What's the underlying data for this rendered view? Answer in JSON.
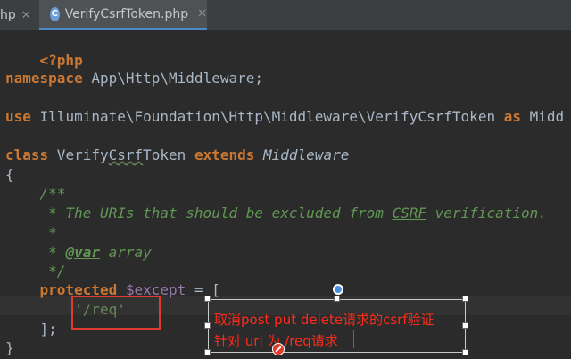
{
  "tabs": {
    "prev_label": "hp",
    "active_label": "VerifyCsrfToken.php",
    "active_icon": "php-file-icon"
  },
  "code": {
    "php_open": "<?php",
    "ns_kw": "namespace",
    "ns_name": " App\\Http\\Middleware;",
    "use_kw": "use",
    "use_path": " Illuminate\\Foundation\\Http\\Middleware\\VerifyCsrfToken ",
    "as_kw": "as",
    "as_name": " Midd",
    "class_kw": "class",
    "class_name_a": " Verify",
    "class_name_b": "Csrf",
    "class_name_c": "Token ",
    "extends_kw": "extends",
    "extends_name": " Middleware",
    "brace_open": "{",
    "doc_open": "    /**",
    "doc_line1_a": "     * The URIs that should be excluded from ",
    "doc_line1_b": "CSRF",
    "doc_line1_c": " verification.",
    "doc_blank": "     *",
    "doc_tag_prefix": "     * ",
    "doc_tag": "@var",
    "doc_tag_rest": " array",
    "doc_close": "     */",
    "prop_indent": "    ",
    "prop_kw": "protected",
    "prop_var": " $except",
    "prop_rest": " = [",
    "str_indent": "        ",
    "str_val": "'/req'",
    "arr_close": "    ];",
    "brace_close": "}"
  },
  "annotation": {
    "line1": "取消post put delete请求的csrf验证",
    "line2": "针对 uri 为 /req请求"
  },
  "colors": {
    "background": "#2b2b2b",
    "keyword": "#cc7832",
    "comment": "#629755",
    "string": "#6a8759",
    "variable": "#9876aa",
    "annotation_text": "#ff2a1a",
    "highlight_box": "#e03a2c"
  }
}
